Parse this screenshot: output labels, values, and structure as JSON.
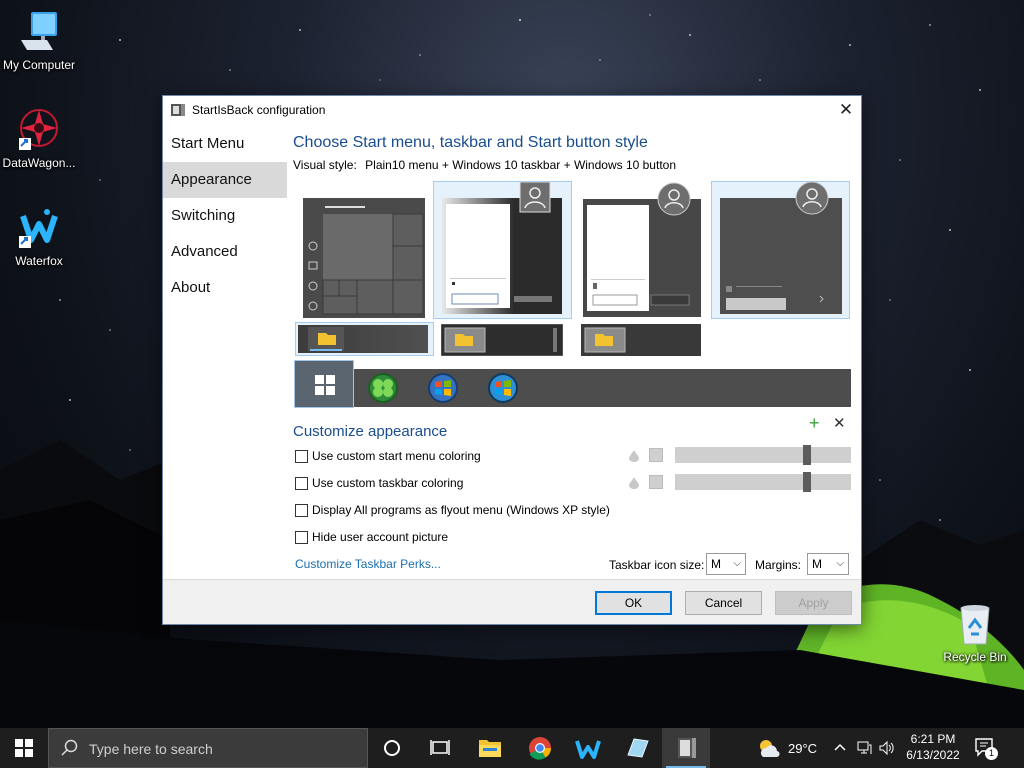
{
  "desktop": {
    "icons": [
      {
        "label": "My Computer"
      },
      {
        "label": "DataWagon..."
      },
      {
        "label": "Waterfox"
      },
      {
        "label": "Recycle Bin"
      }
    ]
  },
  "dialog": {
    "title": "StartIsBack configuration",
    "close_glyph": "✕",
    "sidebar": [
      {
        "label": "Start Menu"
      },
      {
        "label": "Appearance",
        "active": true
      },
      {
        "label": "Switching"
      },
      {
        "label": "Advanced"
      },
      {
        "label": "About"
      }
    ],
    "style_heading": "Choose Start menu, taskbar and Start button style",
    "visual_style_label": "Visual style:",
    "visual_style_value": "Plain10 menu + Windows 10 taskbar + Windows 10 button",
    "customize_heading": "Customize appearance",
    "add_glyph": "+",
    "remove_glyph": "✕",
    "options": [
      {
        "label": "Use custom start menu coloring",
        "checked": false
      },
      {
        "label": "Use custom taskbar coloring",
        "checked": false
      },
      {
        "label": "Display All programs as flyout menu (Windows XP style)",
        "checked": false
      },
      {
        "label": "Hide user account picture",
        "checked": false
      }
    ],
    "perks_link": "Customize Taskbar Perks...",
    "icon_size_label": "Taskbar icon size:",
    "icon_size_value": "M",
    "margins_label": "Margins:",
    "margins_value": "M",
    "chevron": "⌵",
    "buttons": {
      "ok": "OK",
      "cancel": "Cancel",
      "apply": "Apply"
    }
  },
  "taskbar": {
    "search_placeholder": "Type here to search",
    "weather_temp": "29°C",
    "time": "6:21 PM",
    "date": "6/13/2022",
    "notification_count": "1"
  },
  "colors": {
    "accent": "#0078d7",
    "heading": "#1a4d8f",
    "link": "#1a6fae",
    "selection_bg": "#e5f1fb",
    "selection_border": "#a5cdef"
  }
}
